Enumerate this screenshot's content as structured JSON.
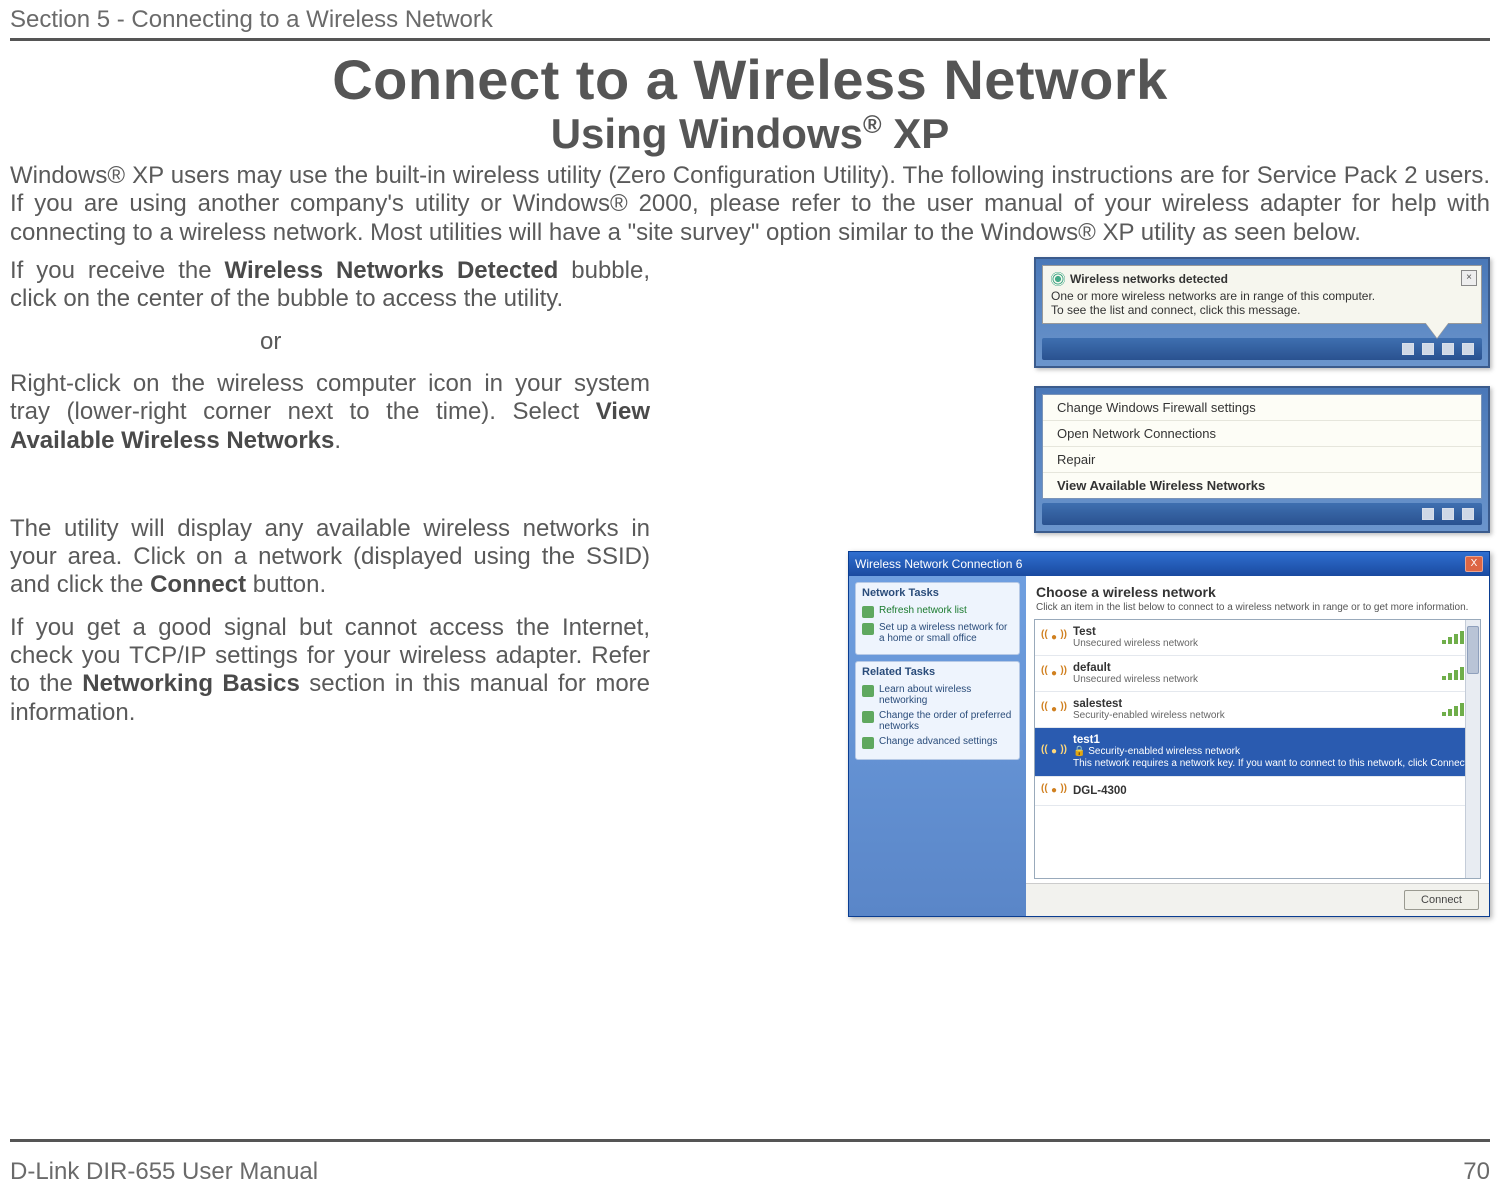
{
  "header": {
    "section": "Section 5 - Connecting to a Wireless Network"
  },
  "title": {
    "main": "Connect to a Wireless Network",
    "sub_pre": "Using Windows",
    "sub_post": " XP"
  },
  "intro": "Windows® XP users may use the built-in wireless utility (Zero Configuration Utility). The following instructions are for Service Pack 2 users.  If you are using another company's utility or Windows® 2000, please refer to the user manual of your wireless adapter for help with connecting to a wireless network. Most utilities will have a \"site survey\" option similar to the Windows® XP utility as seen below.",
  "p1_a": "If you receive the ",
  "p1_bold": "Wireless Networks Detected",
  "p1_b": " bubble, click on the center of the bubble to access the utility.",
  "or_label": "or",
  "p2_a": "Right-click on the wireless computer icon in your system tray (lower-right corner next to the time). Select ",
  "p2_bold": "View Available Wireless Networks",
  "p2_b": ".",
  "p3_a": "The utility will display any available wireless networks in your area. Click on a network (displayed using the SSID) and click the ",
  "p3_bold": "Connect",
  "p3_b": " button.",
  "p4_a": "If you get a good signal but cannot access the Internet, check you TCP/IP settings for your wireless adapter. Refer to the ",
  "p4_bold": "Networking Basics",
  "p4_b": " section in this manual for more information.",
  "bubble": {
    "title": "Wireless networks detected",
    "line1": "One or more wireless networks are in range of this computer.",
    "line2": "To see the list and connect, click this message."
  },
  "ctx": {
    "i1": "Change Windows Firewall settings",
    "i2": "Open Network Connections",
    "i3": "Repair",
    "i4": "View Available Wireless Networks"
  },
  "win": {
    "title": "Wireless Network Connection 6",
    "side1_hd": "Network Tasks",
    "side1_i1": "Refresh network list",
    "side1_i2": "Set up a wireless network for a home or small office",
    "side2_hd": "Related Tasks",
    "side2_i1": "Learn about wireless networking",
    "side2_i2": "Change the order of preferred networks",
    "side2_i3": "Change advanced settings",
    "main_hd": "Choose a wireless network",
    "main_sub": "Click an item in the list below to connect to a wireless network in range or to get more information.",
    "n1_name": "Test",
    "n1_desc": "Unsecured wireless network",
    "n2_name": "default",
    "n2_desc": "Unsecured wireless network",
    "n3_name": "salestest",
    "n3_desc": "Security-enabled wireless network",
    "n4_name": "test1",
    "n4_desc1": "Security-enabled wireless network",
    "n4_desc2": "This network requires a network key. If you want to connect to this network, click Connect.",
    "n5_name": "DGL-4300",
    "connect": "Connect"
  },
  "footer": {
    "left": "D-Link DIR-655 User Manual",
    "right": "70"
  }
}
